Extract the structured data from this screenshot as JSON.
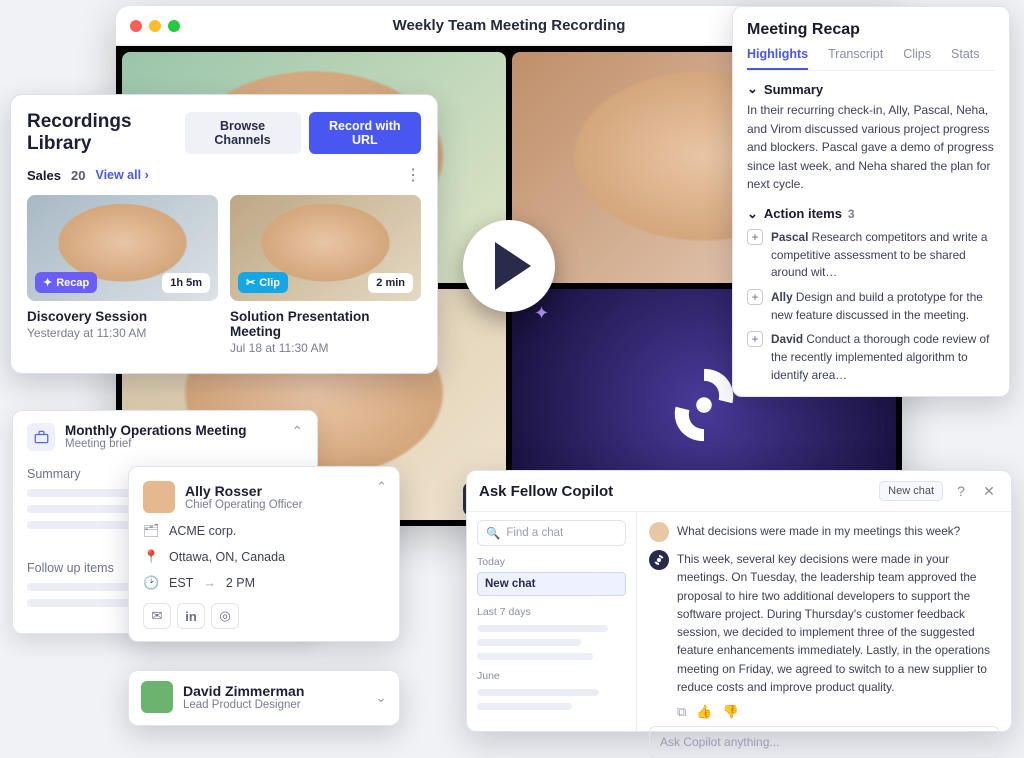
{
  "window": {
    "title": "Weekly Team Meeting Recording"
  },
  "library": {
    "title": "Recordings Library",
    "browse_btn": "Browse Channels",
    "record_btn": "Record with URL",
    "filter_label": "Sales",
    "filter_count": "20",
    "viewall": "View all",
    "cards": [
      {
        "badge": "Recap",
        "duration": "1h 5m",
        "title": "Discovery Session",
        "time": "Yesterday at 11:30 AM"
      },
      {
        "badge": "Clip",
        "duration": "2 min",
        "title": "Solution Presentation Meeting",
        "time": "Jul 18 at 11:30 AM"
      }
    ]
  },
  "brief": {
    "title": "Monthly Operations Meeting",
    "sub": "Meeting brief",
    "sec1": "Summary",
    "sec2": "Follow up items"
  },
  "profile": {
    "name": "Ally Rosser",
    "role": "Chief Operating Officer",
    "company": "ACME corp.",
    "location": "Ottawa, ON, Canada",
    "tz": "EST",
    "time": "2 PM"
  },
  "profile2": {
    "name": "David Zimmerman",
    "role": "Lead Product Designer"
  },
  "recap": {
    "title": "Meeting Recap",
    "tabs": [
      "Highlights",
      "Transcript",
      "Clips",
      "Stats"
    ],
    "summary_head": "Summary",
    "summary_text": "In their recurring check-in, Ally, Pascal, Neha, and Virom discussed various project progress and blockers. Pascal gave a demo of progress since last week, and Neha shared the plan for next cycle.",
    "actions_head": "Action items",
    "actions_count": "3",
    "items": [
      {
        "who": "Pascal",
        "text": "Research competitors and write a competitive assessment to be shared around wit…"
      },
      {
        "who": "Ally",
        "text": "Design and build a prototype for the new feature discussed in the meeting."
      },
      {
        "who": "David",
        "text": "Conduct a thorough code review of the recently implemented algorithm to identify area…"
      }
    ]
  },
  "copilot": {
    "title": "Ask Fellow Copilot",
    "newchat": "New chat",
    "search_ph": "Find a chat",
    "today": "Today",
    "todays_chat": "New chat",
    "last7": "Last 7 days",
    "june": "June",
    "user_msg": "What decisions were made in my meetings this week?",
    "bot_msg": "This week, several key decisions were made in your meetings. On Tuesday, the leadership team approved the proposal to hire two additional developers to support the software project. During Thursday's customer feedback session, we decided to implement three of the suggested feature enhancements immediately. Lastly, in the operations meeting on Friday, we agreed to switch to a new supplier to reduce costs and improve product quality.",
    "input_ph": "Ask Copilot anything..."
  }
}
